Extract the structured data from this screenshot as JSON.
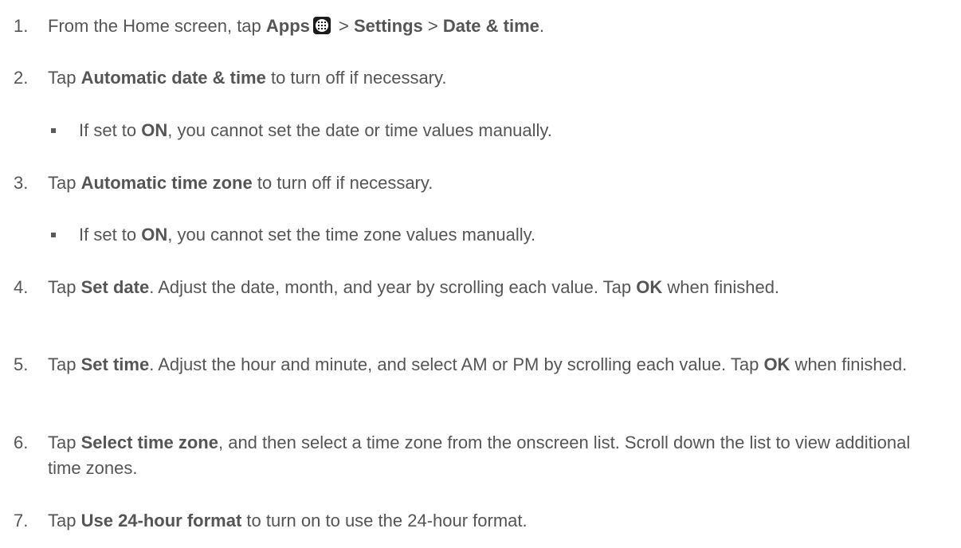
{
  "steps": [
    {
      "num": "1.",
      "parts": [
        "From the Home screen, tap ",
        "Apps",
        " > ",
        "Settings",
        " > ",
        "Date & time",
        "."
      ]
    },
    {
      "num": "2.",
      "parts": [
        "Tap ",
        "Automatic date & time",
        " to turn off if necessary."
      ],
      "sub": [
        "If set to ",
        "ON",
        ", you cannot set the date or time values manually."
      ]
    },
    {
      "num": "3.",
      "parts": [
        "Tap ",
        "Automatic time zone",
        " to turn off if necessary."
      ],
      "sub": [
        "If set to ",
        "ON",
        ", you cannot set the time zone values manually."
      ]
    },
    {
      "num": "4.",
      "parts": [
        "Tap ",
        "Set date",
        ". Adjust the date, month, and year by scrolling each value. Tap ",
        "OK",
        " when finished."
      ]
    },
    {
      "num": "5.",
      "parts": [
        "Tap ",
        "Set time",
        ". Adjust the hour and minute, and select AM or PM by scrolling each value. Tap ",
        "OK",
        " when finished."
      ]
    },
    {
      "num": "6.",
      "parts": [
        "Tap ",
        "Select time zone",
        ", and then select a time zone from the onscreen list. Scroll down the list to view additional time zones."
      ]
    },
    {
      "num": "7.",
      "parts": [
        "Tap ",
        "Use 24-hour format",
        " to turn on to use the 24-hour format."
      ]
    }
  ],
  "icons": {
    "apps": "apps-grid-icon"
  }
}
